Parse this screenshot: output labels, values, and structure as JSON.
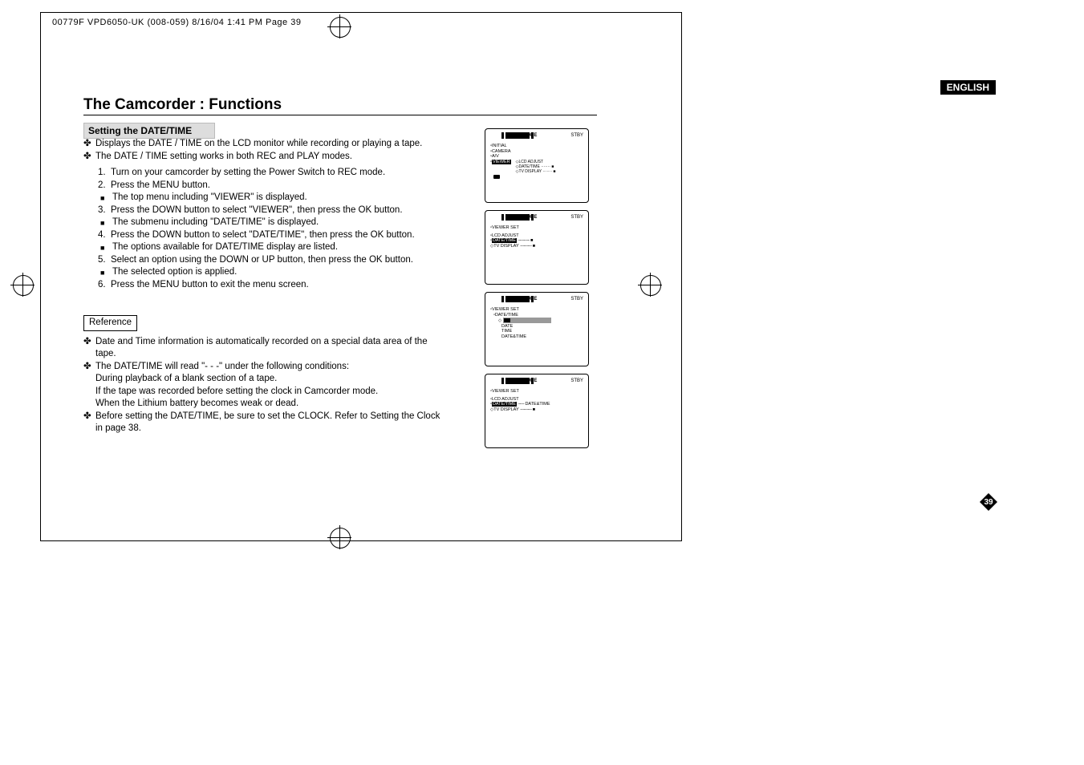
{
  "header_line": "00779F VPD6050-UK (008-059)  8/16/04 1:41 PM  Page 39",
  "english": "ENGLISH",
  "title": "The Camcorder : Functions",
  "subheading": "Setting the DATE/TIME",
  "intro": [
    "Displays the DATE / TIME on the LCD monitor while recording or playing a tape.",
    "The DATE / TIME setting works in both REC and PLAY modes."
  ],
  "steps": [
    {
      "n": "1.",
      "t": "Turn on your camcorder by setting the Power Switch to REC mode."
    },
    {
      "n": "2.",
      "t": "Press the MENU button.",
      "sub": "The top menu including \"VIEWER\" is displayed."
    },
    {
      "n": "3.",
      "t": "Press the DOWN button to select \"VIEWER\", then press the OK button.",
      "sub": "The submenu including \"DATE/TIME\" is displayed."
    },
    {
      "n": "4.",
      "t": "Press the DOWN button to select \"DATE/TIME\", then press the OK button.",
      "sub": "The options available for DATE/TIME display are listed."
    },
    {
      "n": "5.",
      "t": "Select an option using the DOWN or UP button, then press the OK button.",
      "sub": "The selected option is applied."
    },
    {
      "n": "6.",
      "t": "Press the MENU button to exit the menu screen."
    }
  ],
  "reference_label": "Reference",
  "reference": [
    "Date and Time information is automatically recorded on a special data area of the tape.",
    "The DATE/TIME will read \"- - -\" under the following conditions:",
    "During playback of a blank section of a tape.",
    "If the tape was recorded before setting the clock in Camcorder mode.",
    "When the Lithium battery becomes weak or dead.",
    "Before setting the DATE/TIME, be sure to set the CLOCK. Refer to Setting the Clock in page 38."
  ],
  "page_number": "39",
  "screens": {
    "s1": {
      "title": "REC MODE",
      "stby": "STBY",
      "lines": [
        "INITIAL",
        "CAMERA",
        "A/V",
        "VIEWER"
      ],
      "right": [
        "LCD ADJUST",
        "DATE/TIME",
        "TV DISPLAY"
      ]
    },
    "s2": {
      "title": "REC MODE",
      "stby": "STBY",
      "head": "VIEWER SET",
      "lines": [
        "LCD ADJUST",
        "DATE/TIME",
        "TV DISPLAY"
      ]
    },
    "s3": {
      "title": "REC MODE",
      "stby": "STBY",
      "head": "VIEWER SET",
      "sub": "DATE/TIME",
      "lines": [
        "",
        "DATE",
        "TIME",
        "DATE&TIME"
      ]
    },
    "s4": {
      "title": "REC MODE",
      "stby": "STBY",
      "head": "VIEWER SET",
      "lines": [
        "LCD ADJUST",
        "DATE/TIME",
        "TV DISPLAY"
      ],
      "val": "DATE&TIME"
    }
  }
}
